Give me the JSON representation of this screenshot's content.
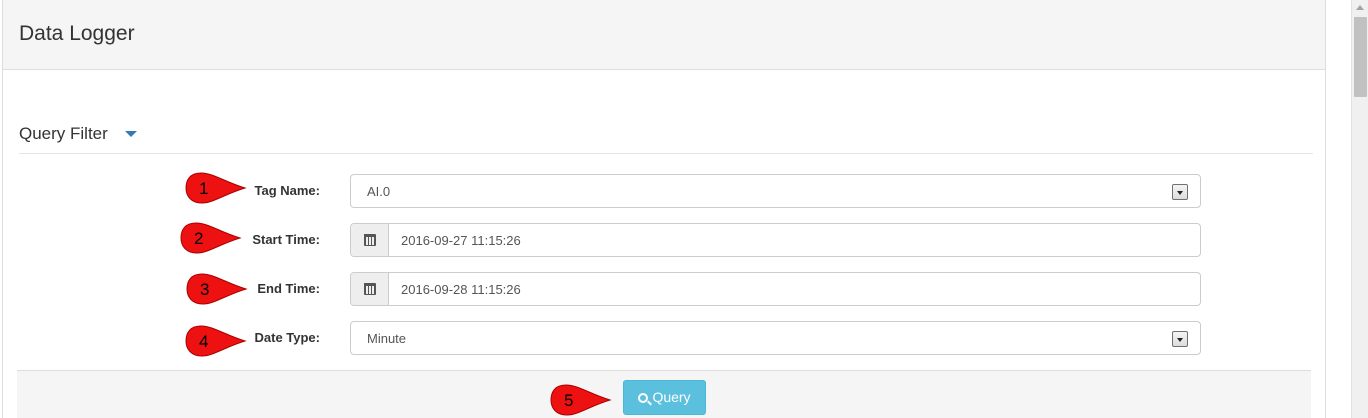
{
  "panel": {
    "title": "Data Logger"
  },
  "filter": {
    "header": "Query Filter",
    "tag_name": {
      "label": "Tag Name:",
      "value": "AI.0"
    },
    "start_time": {
      "label": "Start Time:",
      "value": "2016-09-27 11:15:26"
    },
    "end_time": {
      "label": "End Time:",
      "value": "2016-09-28 11:15:26"
    },
    "date_type": {
      "label": "Date Type:",
      "value": "Minute"
    }
  },
  "actions": {
    "query_label": "Query"
  },
  "markers": [
    "1",
    "2",
    "3",
    "4",
    "5"
  ],
  "colors": {
    "accent": "#5bc0de",
    "caret": "#337ab7",
    "marker": "#ee1111"
  },
  "icons": [
    "chevron-down-icon",
    "calendar-icon",
    "search-icon"
  ]
}
